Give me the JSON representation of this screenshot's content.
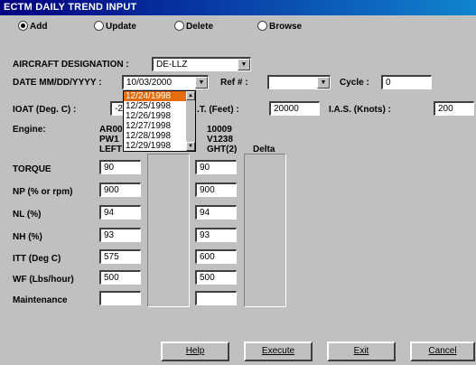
{
  "window": {
    "title": "ECTM DAILY TREND INPUT"
  },
  "modes": [
    {
      "label": "Add",
      "selected": true
    },
    {
      "label": "Update",
      "selected": false
    },
    {
      "label": "Delete",
      "selected": false
    },
    {
      "label": "Browse",
      "selected": false
    }
  ],
  "aircraft": {
    "label": "AIRCRAFT DESIGNATION :",
    "value": "DE-LLZ"
  },
  "date": {
    "label": "DATE MM/DD/YYYY :",
    "value": "10/03/2000",
    "options": [
      "12/24/1998",
      "12/25/1998",
      "12/26/1998",
      "12/27/1998",
      "12/28/1998",
      "12/29/1998"
    ],
    "highlighted": "12/24/1998"
  },
  "ref": {
    "label": "Ref # :",
    "value": ""
  },
  "cycle": {
    "label": "Cycle :",
    "value": "0"
  },
  "ioat": {
    "label": "IOAT (Deg. C) :",
    "value": "-2"
  },
  "pa": {
    "label_suffix": ".T. (Feet) :",
    "value": "20000"
  },
  "ias": {
    "label": "I.A.S. (Knots) :",
    "value": "200"
  },
  "engine": {
    "label": "Engine:",
    "left_lines": [
      "AR00",
      "PW1",
      "LEFT"
    ],
    "right_lines": [
      "10009",
      "V1238",
      "GHT(2)"
    ],
    "delta_label": "Delta"
  },
  "params": [
    {
      "label": "TORQUE",
      "left": "90",
      "right": "90"
    },
    {
      "label": "NP (% or rpm)",
      "left": "900",
      "right": "900"
    },
    {
      "label": "NL (%)",
      "left": "94",
      "right": "94"
    },
    {
      "label": "NH (%)",
      "left": "93",
      "right": "93"
    },
    {
      "label": "ITT (Deg C)",
      "left": "575",
      "right": "600"
    },
    {
      "label": "WF (Lbs/hour)",
      "left": "500",
      "right": "500"
    },
    {
      "label": "Maintenance",
      "left": "",
      "right": ""
    }
  ],
  "buttons": {
    "help": "Help",
    "execute": "Execute",
    "exit": "Exit",
    "cancel": "Cancel"
  }
}
